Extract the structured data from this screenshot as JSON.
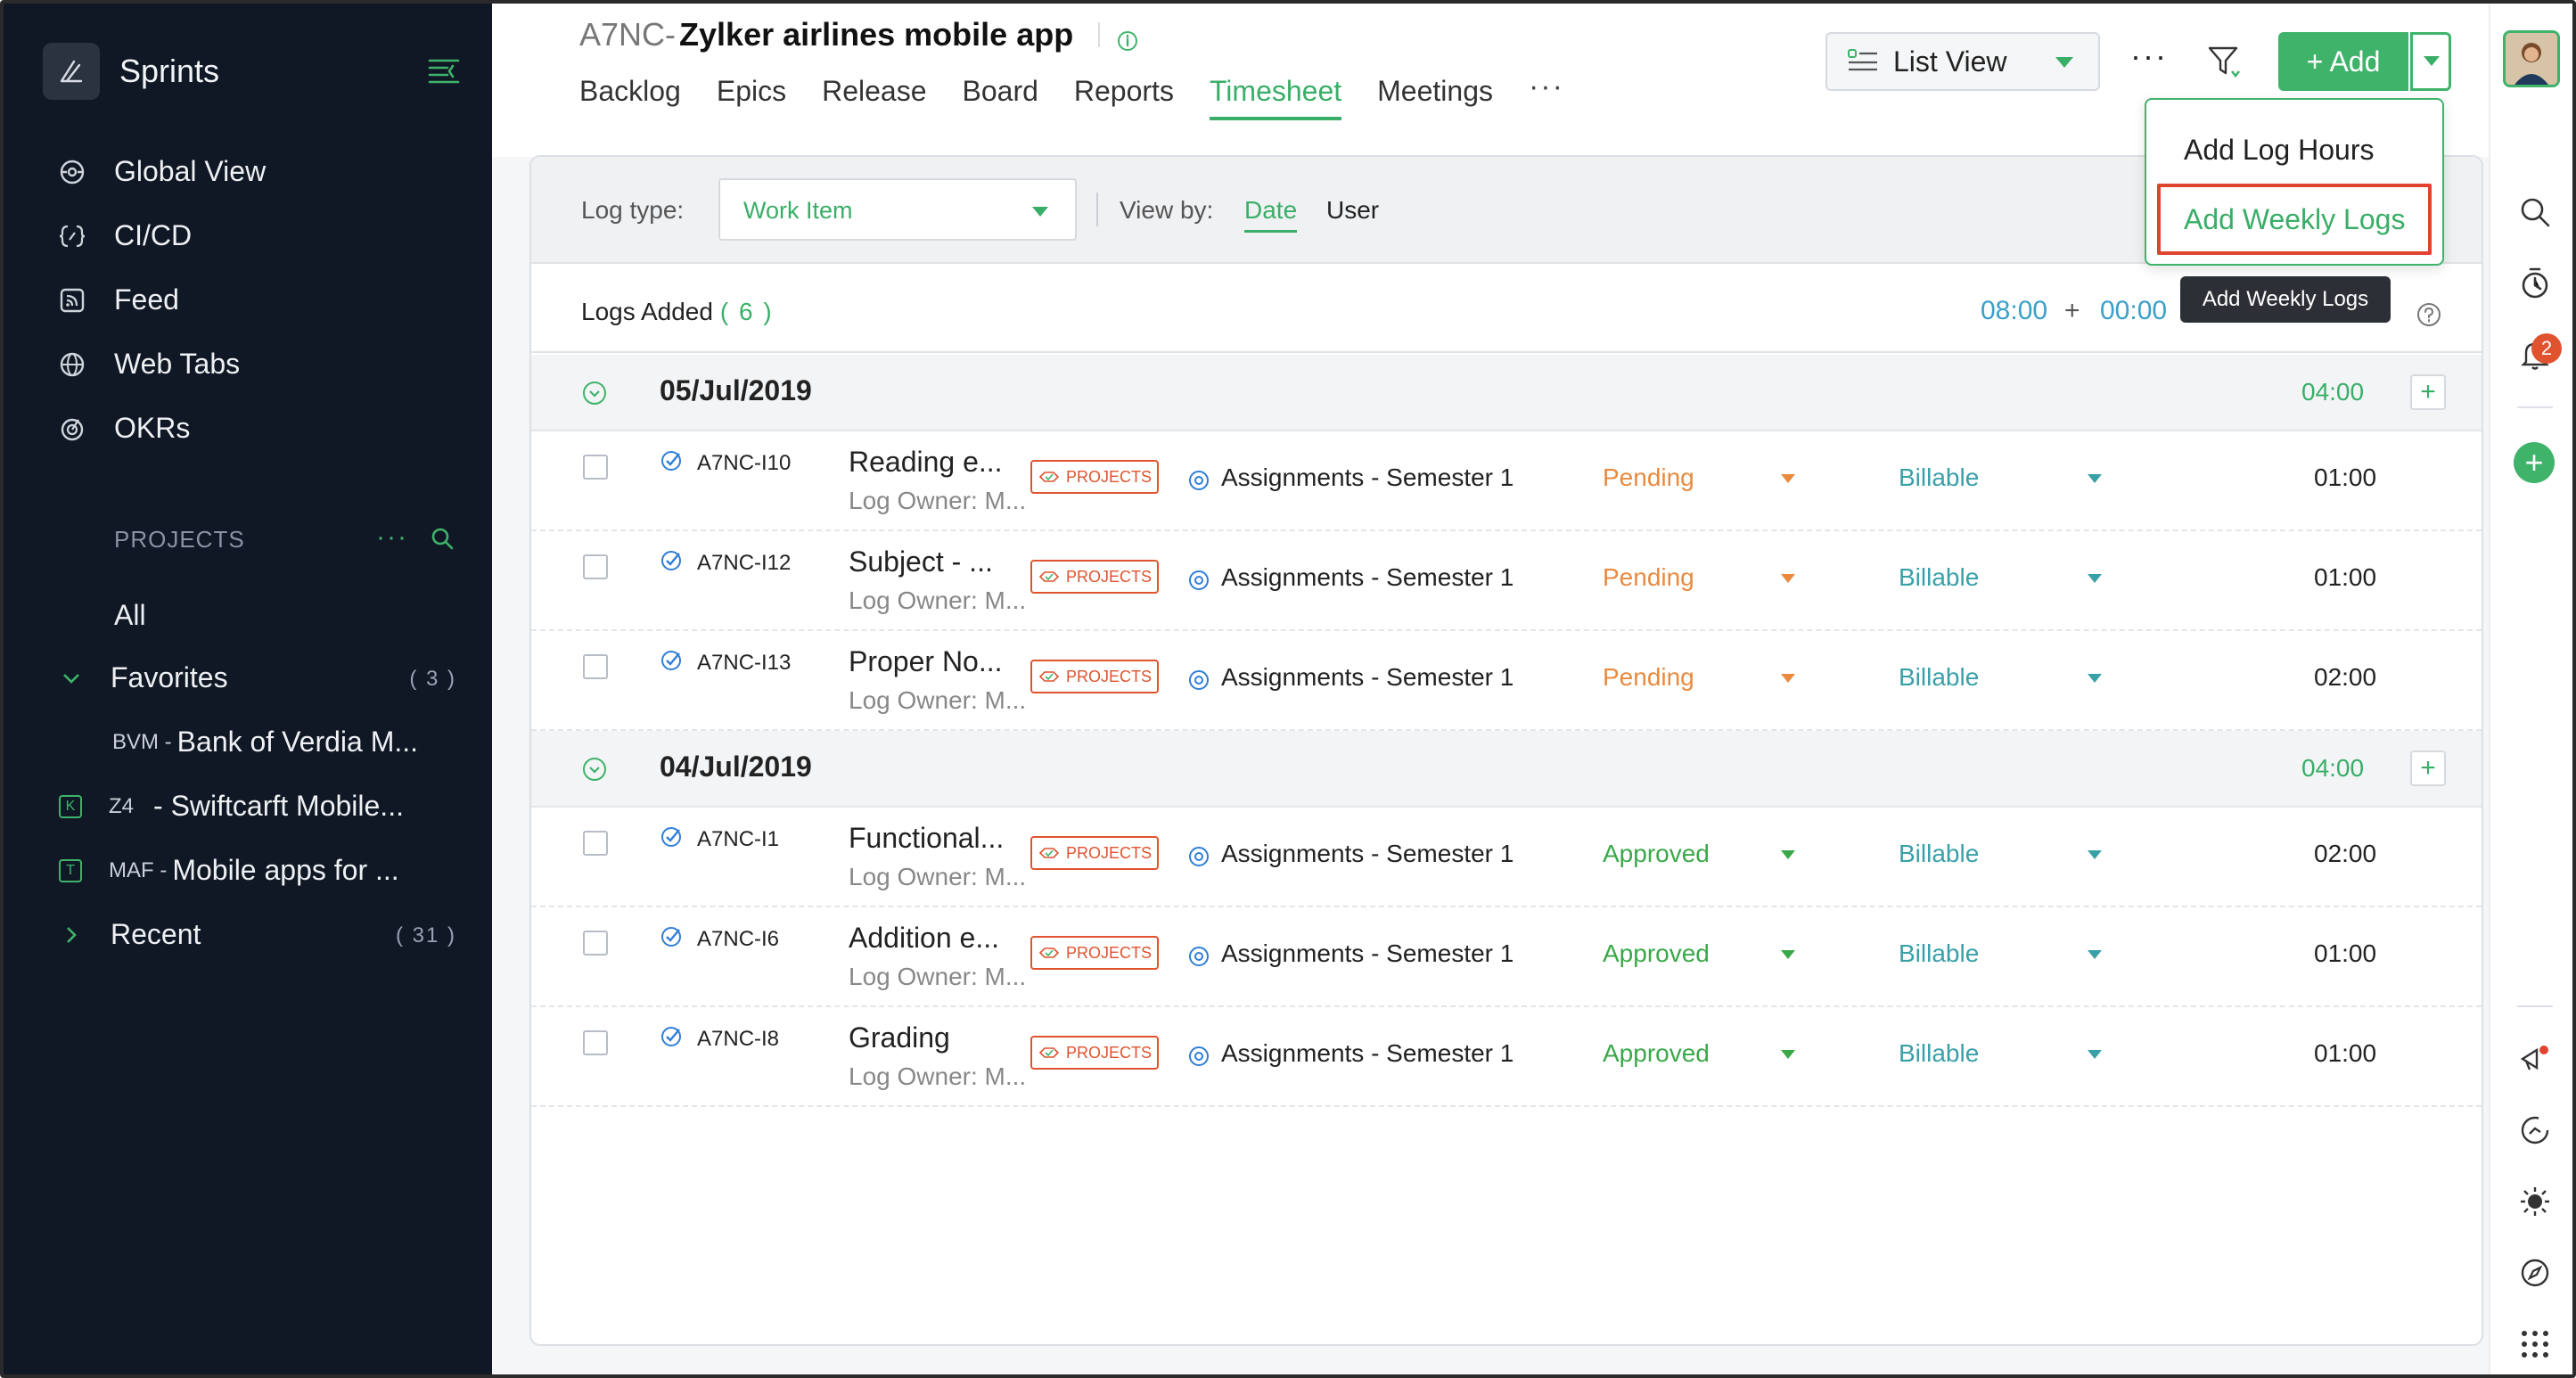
{
  "app": {
    "name": "Sprints"
  },
  "nav": [
    {
      "label": "Global View",
      "icon": "global-view-icon"
    },
    {
      "label": "CI/CD",
      "icon": "cicd-icon"
    },
    {
      "label": "Feed",
      "icon": "feed-icon"
    },
    {
      "label": "Web Tabs",
      "icon": "web-tabs-icon"
    },
    {
      "label": "OKRs",
      "icon": "okrs-icon"
    }
  ],
  "projects": {
    "heading": "PROJECTS",
    "all_label": "All",
    "favorites": {
      "label": "Favorites",
      "count": "( 3 )"
    },
    "items": [
      {
        "code": "BVM -",
        "name": "Bank of Verdia M..."
      },
      {
        "code": "Z4",
        "name": "- Swiftcarft Mobile..."
      },
      {
        "code": "MAF -",
        "name": "Mobile apps for ..."
      }
    ],
    "recent": {
      "label": "Recent",
      "count": "( 31 )"
    }
  },
  "header": {
    "project_prefix": "A7NC-",
    "project_name": "Zylker airlines mobile app",
    "tabs": [
      "Backlog",
      "Epics",
      "Release",
      "Board",
      "Reports",
      "Timesheet",
      "Meetings"
    ],
    "active_tab": "Timesheet",
    "more": "···",
    "view_select": "List View",
    "add_label": "+ Add"
  },
  "filters": {
    "log_type_label": "Log type:",
    "log_type_value": "Work Item",
    "view_by_label": "View by:",
    "view_by_options": [
      "Date",
      "User"
    ]
  },
  "logs_bar": {
    "label": "Logs Added",
    "count": "( 6 )",
    "time_a": "08:00",
    "plus": "+",
    "time_b": "00:00"
  },
  "groups": [
    {
      "date": "05/Jul/2019",
      "total": "04:00",
      "rows": [
        {
          "id": "A7NC-I10",
          "name": "Reading e...",
          "owner": "Log Owner: M...",
          "tag": "PROJECTS",
          "assignment": "Assignments - Semester 1",
          "status": "Pending",
          "billing": "Billable",
          "hours": "01:00"
        },
        {
          "id": "A7NC-I12",
          "name": "Subject - ...",
          "owner": "Log Owner: M...",
          "tag": "PROJECTS",
          "assignment": "Assignments - Semester 1",
          "status": "Pending",
          "billing": "Billable",
          "hours": "01:00"
        },
        {
          "id": "A7NC-I13",
          "name": "Proper No...",
          "owner": "Log Owner: M...",
          "tag": "PROJECTS",
          "assignment": "Assignments - Semester 1",
          "status": "Pending",
          "billing": "Billable",
          "hours": "02:00"
        }
      ]
    },
    {
      "date": "04/Jul/2019",
      "total": "04:00",
      "rows": [
        {
          "id": "A7NC-I1",
          "name": "Functional...",
          "owner": "Log Owner: M...",
          "tag": "PROJECTS",
          "assignment": "Assignments - Semester 1",
          "status": "Approved",
          "billing": "Billable",
          "hours": "02:00"
        },
        {
          "id": "A7NC-I6",
          "name": "Addition e...",
          "owner": "Log Owner: M...",
          "tag": "PROJECTS",
          "assignment": "Assignments - Semester 1",
          "status": "Approved",
          "billing": "Billable",
          "hours": "01:00"
        },
        {
          "id": "A7NC-I8",
          "name": "Grading",
          "owner": "Log Owner: M...",
          "tag": "PROJECTS",
          "assignment": "Assignments - Semester 1",
          "status": "Approved",
          "billing": "Billable",
          "hours": "01:00"
        }
      ]
    }
  ],
  "dropdown": {
    "items": [
      "Add Log Hours",
      "Add Weekly Logs"
    ],
    "highlighted": "Add Weekly Logs",
    "tooltip": "Add Weekly Logs"
  },
  "rail": {
    "notification_count": "2"
  },
  "colors": {
    "accent_green": "#3fb36a",
    "pending": "#e98a3f",
    "approved": "#3aa84a",
    "billable": "#3aa0a8",
    "sidebar_bg": "#101825",
    "highlight_red": "#e0432f"
  }
}
